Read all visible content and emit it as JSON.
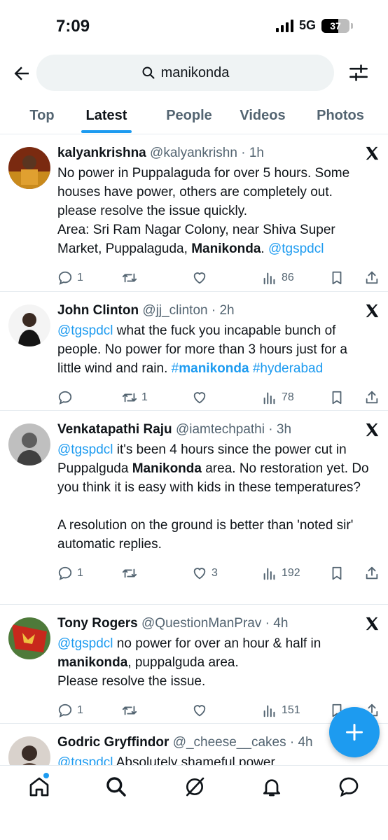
{
  "status_bar": {
    "time": "7:09",
    "network": "5G",
    "battery": "37"
  },
  "search": {
    "query": "manikonda"
  },
  "tabs": [
    {
      "label": "Top"
    },
    {
      "label": "Latest"
    },
    {
      "label": "People"
    },
    {
      "label": "Videos"
    },
    {
      "label": "Photos"
    }
  ],
  "active_tab": "Latest",
  "tweets": [
    {
      "name": "kalyankrishna",
      "handle": "@kalyankrishn",
      "time": "1h",
      "text": {
        "p1": "No power in Puppalaguda for over 5 hours. Some houses have power, others are completely out. please resolve the issue quickly.",
        "p2a": "Area: Sri Ram Nagar Colony, near Shiva Super Market, Puppalaguda, ",
        "p2b": "Manikonda",
        "p2c": ". ",
        "mention": "@tgspdcl"
      },
      "replies": "1",
      "reposts": "",
      "likes": "",
      "views": "86"
    },
    {
      "name": "John Clinton",
      "handle": "@jj_clinton",
      "time": "2h",
      "text": {
        "mention": "@tgspdcl",
        "rest": " what the fuck you incapable bunch of people. No power for more than 3 hours just for a little wind and rain. ",
        "tag1_prefix": "#",
        "tag1": "manikonda",
        "tag2": " #hyderabad"
      },
      "replies": "",
      "reposts": "1",
      "likes": "",
      "views": "78"
    },
    {
      "name": "Venkatapathi Raju",
      "handle": "@iamtechpathi",
      "time": "3h",
      "text": {
        "mention": "@tgspdcl",
        "a": " it's been 4 hours since the power cut in Puppalguda ",
        "bold": "Manikonda",
        "b": " area. No restoration yet. Do you think it is easy with kids in these temperatures?",
        "c": "A resolution on the ground is better than 'noted sir' automatic replies."
      },
      "replies": "1",
      "reposts": "",
      "likes": "3",
      "views": "192"
    },
    {
      "name": "Tony Rogers",
      "handle": "@QuestionManPrav",
      "time": "4h",
      "text": {
        "mention": "@tgspdcl",
        "a": " no power for over an hour & half in ",
        "bold": "manikonda",
        "b": ", puppalguda area.",
        "c": "Please resolve the issue."
      },
      "replies": "1",
      "reposts": "",
      "likes": "",
      "views": "151"
    },
    {
      "name": "Godric Gryffindor",
      "handle": "@_cheese__cakes",
      "time": "4h",
      "text": {
        "mention": "@tgspdcl",
        "a": " Absolutely shameful power"
      }
    }
  ],
  "colors": {
    "accent": "#1d9bf0",
    "text": "#0f1419",
    "muted": "#536471"
  }
}
